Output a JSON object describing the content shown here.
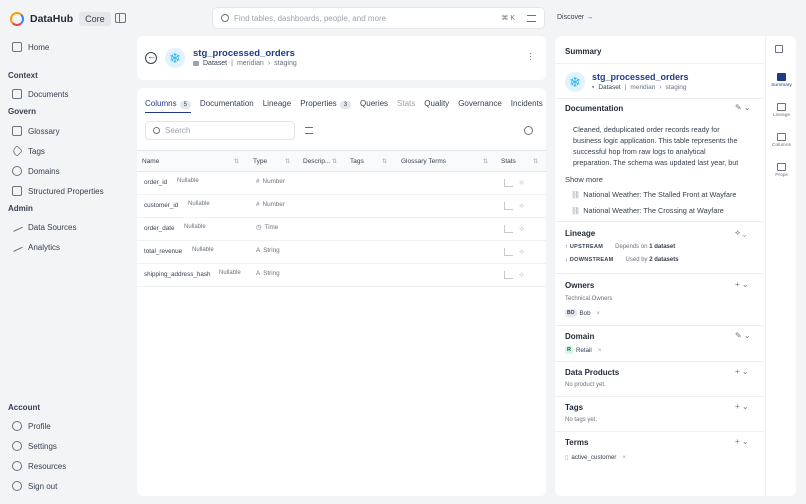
{
  "brand": {
    "name": "DataHub",
    "badge": "Core"
  },
  "sidebar": {
    "home": "Home",
    "sections": {
      "context": {
        "title": "Context",
        "items": [
          "Documents"
        ]
      },
      "govern": {
        "title": "Govern",
        "items": [
          "Glossary",
          "Tags",
          "Domains",
          "Structured Properties"
        ]
      },
      "admin": {
        "title": "Admin",
        "items": [
          "Data Sources",
          "Analytics"
        ]
      },
      "account": {
        "title": "Account",
        "items": [
          "Profile",
          "Settings",
          "Resources",
          "Sign out"
        ]
      }
    }
  },
  "search": {
    "placeholder": "Find tables, dashboards, people, and more",
    "shortcut": "⌘ K"
  },
  "discover": "Discover →",
  "entity": {
    "name": "stg_processed_orders",
    "type": "Dataset",
    "path": [
      "meridian",
      "staging"
    ]
  },
  "tabs": [
    {
      "label": "Columns",
      "count": "5"
    },
    {
      "label": "Documentation"
    },
    {
      "label": "Lineage"
    },
    {
      "label": "Properties",
      "count": "3"
    },
    {
      "label": "Queries"
    },
    {
      "label": "Stats"
    },
    {
      "label": "Quality"
    },
    {
      "label": "Governance"
    },
    {
      "label": "Incidents"
    }
  ],
  "columns_search": {
    "placeholder": "Search"
  },
  "table": {
    "headers": [
      "Name",
      "Type",
      "Descrip...",
      "Tags",
      "Glossary Terms",
      "Stats"
    ],
    "rows": [
      {
        "name": "order_id",
        "nullable": "Nullable",
        "type": "Number",
        "type_icon": "#"
      },
      {
        "name": "customer_id",
        "nullable": "Nullable",
        "type": "Number",
        "type_icon": "#"
      },
      {
        "name": "order_date",
        "nullable": "Nullable",
        "type": "Time",
        "type_icon": "◷"
      },
      {
        "name": "total_revenue",
        "nullable": "Nullable",
        "type": "String",
        "type_icon": "A"
      },
      {
        "name": "shipping_address_hash",
        "nullable": "Nullable",
        "type": "String",
        "type_icon": "A"
      }
    ]
  },
  "summary": {
    "title": "Summary",
    "documentation": {
      "title": "Documentation",
      "text": "Cleaned, deduplicated order records ready for business logic application. This table represents the successful hop from raw logs to analytical preparation. The schema was updated last year, but",
      "show_more": "Show more",
      "links": [
        "National Weather: The Stalled Front at Wayfare",
        "National Weather: The Crossing at Wayfare"
      ]
    },
    "lineage": {
      "title": "Lineage",
      "upstream_label": "UPSTREAM",
      "upstream_text": "Depends on",
      "upstream_count": "1 dataset",
      "downstream_label": "DOWNSTREAM",
      "downstream_text": "Used by",
      "downstream_count": "2 datasets"
    },
    "owners": {
      "title": "Owners",
      "subtitle": "Technical Owners",
      "owner_initials": "BO",
      "owner": "Bob"
    },
    "domain": {
      "title": "Domain",
      "badge": "R",
      "value": "Retail"
    },
    "data_products": {
      "title": "Data Products",
      "empty": "No product yet."
    },
    "tags": {
      "title": "Tags",
      "empty": "No tags yet."
    },
    "terms": {
      "title": "Terms",
      "value": "active_customer"
    }
  },
  "rail": [
    "Summary",
    "Lineage",
    "Columns",
    "Props"
  ]
}
